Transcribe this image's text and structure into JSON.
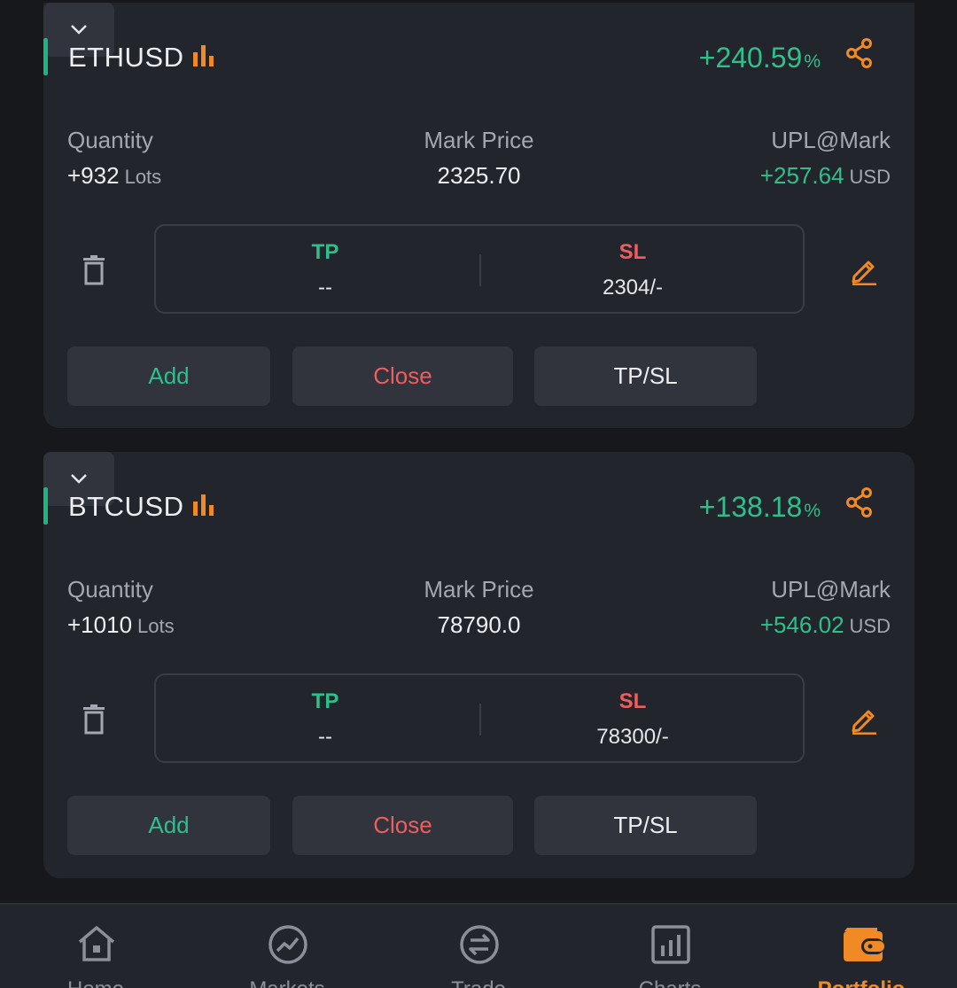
{
  "positions": [
    {
      "symbol": "ETHUSD",
      "pnl_sign": "+",
      "pnl_value": "240.59",
      "pnl_unit": "%",
      "quantity_label": "Quantity",
      "quantity_value": "+932",
      "quantity_unit": "Lots",
      "mark_label": "Mark Price",
      "mark_value": "2325.70",
      "upl_label": "UPL@Mark",
      "upl_value": "+257.64",
      "upl_unit": "USD",
      "tp_label": "TP",
      "tp_value": "--",
      "sl_label": "SL",
      "sl_value": "2304/-",
      "add_label": "Add",
      "close_label": "Close",
      "tpsl_label": "TP/SL"
    },
    {
      "symbol": "BTCUSD",
      "pnl_sign": "+",
      "pnl_value": "138.18",
      "pnl_unit": "%",
      "quantity_label": "Quantity",
      "quantity_value": "+1010",
      "quantity_unit": "Lots",
      "mark_label": "Mark Price",
      "mark_value": "78790.0",
      "upl_label": "UPL@Mark",
      "upl_value": "+546.02",
      "upl_unit": "USD",
      "tp_label": "TP",
      "tp_value": "--",
      "sl_label": "SL",
      "sl_value": "78300/-",
      "add_label": "Add",
      "close_label": "Close",
      "tpsl_label": "TP/SL"
    }
  ],
  "tabbar": {
    "tabs": [
      {
        "label": "Home",
        "icon": "home-icon",
        "active": false
      },
      {
        "label": "Markets",
        "icon": "markets-icon",
        "active": false
      },
      {
        "label": "Trade",
        "icon": "trade-icon",
        "active": false
      },
      {
        "label": "Charts",
        "icon": "charts-icon",
        "active": false
      },
      {
        "label": "Portfolio",
        "icon": "portfolio-wallet-icon",
        "active": true
      }
    ]
  },
  "colors": {
    "accent": "#f08a24",
    "positive": "#2ec08a",
    "negative": "#ee5e5e",
    "background": "#17181c",
    "card": "#23252c"
  }
}
